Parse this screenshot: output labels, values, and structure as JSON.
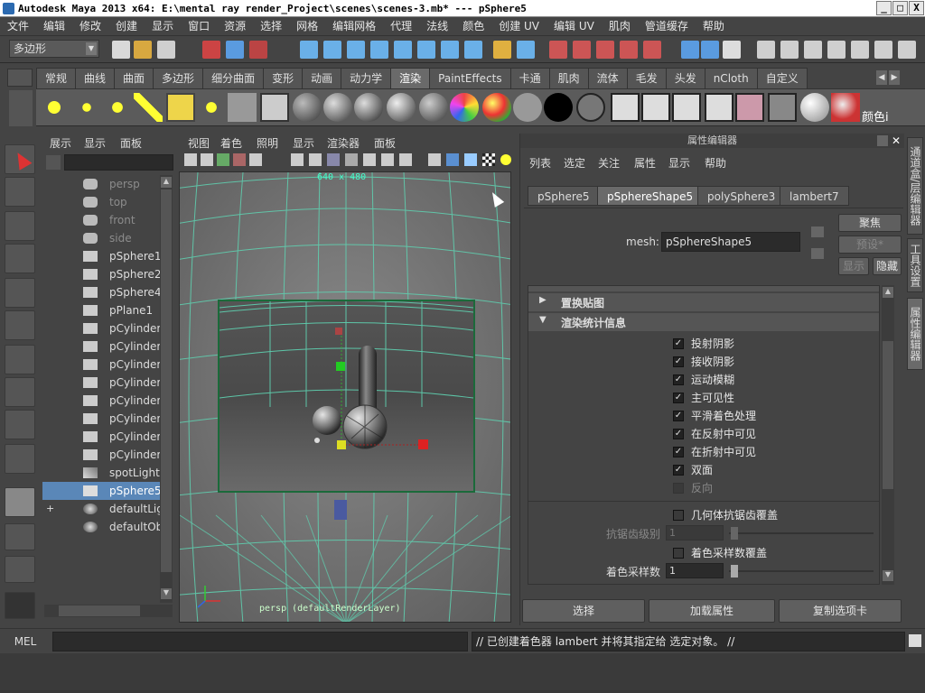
{
  "title": "Autodesk Maya 2013 x64: E:\\mental ray render_Project\\scenes\\scenes-3.mb*   ---   pSphere5",
  "window_buttons": [
    "_",
    "□",
    "X"
  ],
  "menu": [
    "文件",
    "编辑",
    "修改",
    "创建",
    "显示",
    "窗口",
    "资源",
    "选择",
    "网格",
    "编辑网格",
    "代理",
    "法线",
    "颜色",
    "创建 UV",
    "编辑 UV",
    "肌肉",
    "管道缓存",
    "帮助"
  ],
  "mode_dropdown": "多边形",
  "shelf_tabs": [
    "常规",
    "曲线",
    "曲面",
    "多边形",
    "细分曲面",
    "变形",
    "动画",
    "动力学",
    "渲染",
    "PaintEffects",
    "卡通",
    "肌肉",
    "流体",
    "毛发",
    "头发",
    "nCloth",
    "自定义"
  ],
  "active_shelf_tab": "渲染",
  "shelf_end_label": "颜色i",
  "outliner": {
    "items": [
      {
        "label": "persp",
        "dim": true,
        "icon": "camera-icon"
      },
      {
        "label": "top",
        "dim": true,
        "icon": "camera-icon"
      },
      {
        "label": "front",
        "dim": true,
        "icon": "camera-icon"
      },
      {
        "label": "side",
        "dim": true,
        "icon": "camera-icon"
      },
      {
        "label": "pSphere1",
        "dim": false,
        "icon": "mesh-icon"
      },
      {
        "label": "pSphere2",
        "dim": false,
        "icon": "mesh-icon"
      },
      {
        "label": "pSphere4",
        "dim": false,
        "icon": "mesh-icon"
      },
      {
        "label": "pPlane1",
        "dim": false,
        "icon": "mesh-icon"
      },
      {
        "label": "pCylinder2",
        "dim": false,
        "icon": "mesh-icon"
      },
      {
        "label": "pCylinder3",
        "dim": false,
        "icon": "mesh-icon"
      },
      {
        "label": "pCylinder4",
        "dim": false,
        "icon": "mesh-icon"
      },
      {
        "label": "pCylinder5",
        "dim": false,
        "icon": "mesh-icon"
      },
      {
        "label": "pCylinder6",
        "dim": false,
        "icon": "mesh-icon"
      },
      {
        "label": "pCylinder7",
        "dim": false,
        "icon": "mesh-icon"
      },
      {
        "label": "pCylinder8",
        "dim": false,
        "icon": "mesh-icon"
      },
      {
        "label": "pCylinder9",
        "dim": false,
        "icon": "mesh-icon"
      },
      {
        "label": "spotLight1",
        "dim": false,
        "icon": "light-icon"
      },
      {
        "label": "pSphere5",
        "dim": false,
        "icon": "mesh-icon",
        "selected": true
      },
      {
        "label": "defaultLigl",
        "dim": false,
        "icon": "set-icon",
        "expand": "+"
      },
      {
        "label": "defaultObj",
        "dim": false,
        "icon": "set-icon"
      }
    ],
    "menu": [
      "展示",
      "显示",
      "面板"
    ]
  },
  "viewport": {
    "menu": [
      "视图",
      "着色",
      "照明",
      "显示",
      "渲染器",
      "面板"
    ],
    "resolution": "640 x 480",
    "camera_label": "persp (defaultRenderLayer)"
  },
  "attribute_editor": {
    "header": "属性编辑器",
    "menu": [
      "列表",
      "选定",
      "关注",
      "属性",
      "显示",
      "帮助"
    ],
    "tabs": [
      "pSphere5",
      "pSphereShape5",
      "polySphere3",
      "lambert7"
    ],
    "active_tab": "pSphereShape5",
    "mesh_label": "mesh:",
    "mesh_value": "pSphereShape5",
    "focus_button": "聚焦",
    "presets_button": "预设*",
    "show_button": "显示",
    "hide_button": "隐藏",
    "sections": [
      {
        "label": "置换贴图",
        "expanded": false
      },
      {
        "label": "渲染统计信息",
        "expanded": true
      }
    ],
    "checkboxes": [
      {
        "label": "投射阴影",
        "checked": true
      },
      {
        "label": "接收阴影",
        "checked": true
      },
      {
        "label": "运动模糊",
        "checked": true
      },
      {
        "label": "主可见性",
        "checked": true
      },
      {
        "label": "平滑着色处理",
        "checked": true
      },
      {
        "label": "在反射中可见",
        "checked": true
      },
      {
        "label": "在折射中可见",
        "checked": true
      },
      {
        "label": "双面",
        "checked": true
      },
      {
        "label": "反向",
        "checked": false,
        "dim": true
      }
    ],
    "geo_aa_override": "几何体抗锯齿覆盖",
    "aa_level_label": "抗锯齿级别",
    "aa_level_value": "1",
    "shading_samples_override": "着色采样数覆盖",
    "shading_samples_label": "着色采样数",
    "shading_samples_value": "1",
    "bottom_buttons": [
      "选择",
      "加载属性",
      "复制选项卡"
    ]
  },
  "right_tabs": [
    "通道盒/层编辑器",
    "工具设置",
    "属性编辑器"
  ],
  "command_line": {
    "label": "MEL",
    "feedback": "// 已创建着色器 lambert 并将其指定给 选定对象。 //"
  }
}
